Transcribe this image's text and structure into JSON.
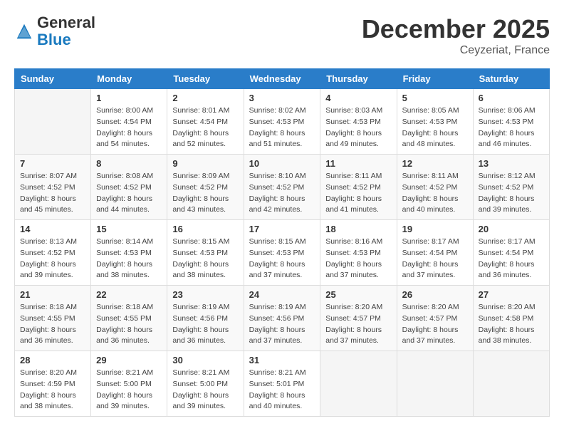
{
  "header": {
    "logo_general": "General",
    "logo_blue": "Blue",
    "month_title": "December 2025",
    "location": "Ceyzeriat, France"
  },
  "weekdays": [
    "Sunday",
    "Monday",
    "Tuesday",
    "Wednesday",
    "Thursday",
    "Friday",
    "Saturday"
  ],
  "weeks": [
    [
      {
        "day": "",
        "info": ""
      },
      {
        "day": "1",
        "info": "Sunrise: 8:00 AM\nSunset: 4:54 PM\nDaylight: 8 hours\nand 54 minutes."
      },
      {
        "day": "2",
        "info": "Sunrise: 8:01 AM\nSunset: 4:54 PM\nDaylight: 8 hours\nand 52 minutes."
      },
      {
        "day": "3",
        "info": "Sunrise: 8:02 AM\nSunset: 4:53 PM\nDaylight: 8 hours\nand 51 minutes."
      },
      {
        "day": "4",
        "info": "Sunrise: 8:03 AM\nSunset: 4:53 PM\nDaylight: 8 hours\nand 49 minutes."
      },
      {
        "day": "5",
        "info": "Sunrise: 8:05 AM\nSunset: 4:53 PM\nDaylight: 8 hours\nand 48 minutes."
      },
      {
        "day": "6",
        "info": "Sunrise: 8:06 AM\nSunset: 4:53 PM\nDaylight: 8 hours\nand 46 minutes."
      }
    ],
    [
      {
        "day": "7",
        "info": "Sunrise: 8:07 AM\nSunset: 4:52 PM\nDaylight: 8 hours\nand 45 minutes."
      },
      {
        "day": "8",
        "info": "Sunrise: 8:08 AM\nSunset: 4:52 PM\nDaylight: 8 hours\nand 44 minutes."
      },
      {
        "day": "9",
        "info": "Sunrise: 8:09 AM\nSunset: 4:52 PM\nDaylight: 8 hours\nand 43 minutes."
      },
      {
        "day": "10",
        "info": "Sunrise: 8:10 AM\nSunset: 4:52 PM\nDaylight: 8 hours\nand 42 minutes."
      },
      {
        "day": "11",
        "info": "Sunrise: 8:11 AM\nSunset: 4:52 PM\nDaylight: 8 hours\nand 41 minutes."
      },
      {
        "day": "12",
        "info": "Sunrise: 8:11 AM\nSunset: 4:52 PM\nDaylight: 8 hours\nand 40 minutes."
      },
      {
        "day": "13",
        "info": "Sunrise: 8:12 AM\nSunset: 4:52 PM\nDaylight: 8 hours\nand 39 minutes."
      }
    ],
    [
      {
        "day": "14",
        "info": "Sunrise: 8:13 AM\nSunset: 4:52 PM\nDaylight: 8 hours\nand 39 minutes."
      },
      {
        "day": "15",
        "info": "Sunrise: 8:14 AM\nSunset: 4:53 PM\nDaylight: 8 hours\nand 38 minutes."
      },
      {
        "day": "16",
        "info": "Sunrise: 8:15 AM\nSunset: 4:53 PM\nDaylight: 8 hours\nand 38 minutes."
      },
      {
        "day": "17",
        "info": "Sunrise: 8:15 AM\nSunset: 4:53 PM\nDaylight: 8 hours\nand 37 minutes."
      },
      {
        "day": "18",
        "info": "Sunrise: 8:16 AM\nSunset: 4:53 PM\nDaylight: 8 hours\nand 37 minutes."
      },
      {
        "day": "19",
        "info": "Sunrise: 8:17 AM\nSunset: 4:54 PM\nDaylight: 8 hours\nand 37 minutes."
      },
      {
        "day": "20",
        "info": "Sunrise: 8:17 AM\nSunset: 4:54 PM\nDaylight: 8 hours\nand 36 minutes."
      }
    ],
    [
      {
        "day": "21",
        "info": "Sunrise: 8:18 AM\nSunset: 4:55 PM\nDaylight: 8 hours\nand 36 minutes."
      },
      {
        "day": "22",
        "info": "Sunrise: 8:18 AM\nSunset: 4:55 PM\nDaylight: 8 hours\nand 36 minutes."
      },
      {
        "day": "23",
        "info": "Sunrise: 8:19 AM\nSunset: 4:56 PM\nDaylight: 8 hours\nand 36 minutes."
      },
      {
        "day": "24",
        "info": "Sunrise: 8:19 AM\nSunset: 4:56 PM\nDaylight: 8 hours\nand 37 minutes."
      },
      {
        "day": "25",
        "info": "Sunrise: 8:20 AM\nSunset: 4:57 PM\nDaylight: 8 hours\nand 37 minutes."
      },
      {
        "day": "26",
        "info": "Sunrise: 8:20 AM\nSunset: 4:57 PM\nDaylight: 8 hours\nand 37 minutes."
      },
      {
        "day": "27",
        "info": "Sunrise: 8:20 AM\nSunset: 4:58 PM\nDaylight: 8 hours\nand 38 minutes."
      }
    ],
    [
      {
        "day": "28",
        "info": "Sunrise: 8:20 AM\nSunset: 4:59 PM\nDaylight: 8 hours\nand 38 minutes."
      },
      {
        "day": "29",
        "info": "Sunrise: 8:21 AM\nSunset: 5:00 PM\nDaylight: 8 hours\nand 39 minutes."
      },
      {
        "day": "30",
        "info": "Sunrise: 8:21 AM\nSunset: 5:00 PM\nDaylight: 8 hours\nand 39 minutes."
      },
      {
        "day": "31",
        "info": "Sunrise: 8:21 AM\nSunset: 5:01 PM\nDaylight: 8 hours\nand 40 minutes."
      },
      {
        "day": "",
        "info": ""
      },
      {
        "day": "",
        "info": ""
      },
      {
        "day": "",
        "info": ""
      }
    ]
  ]
}
